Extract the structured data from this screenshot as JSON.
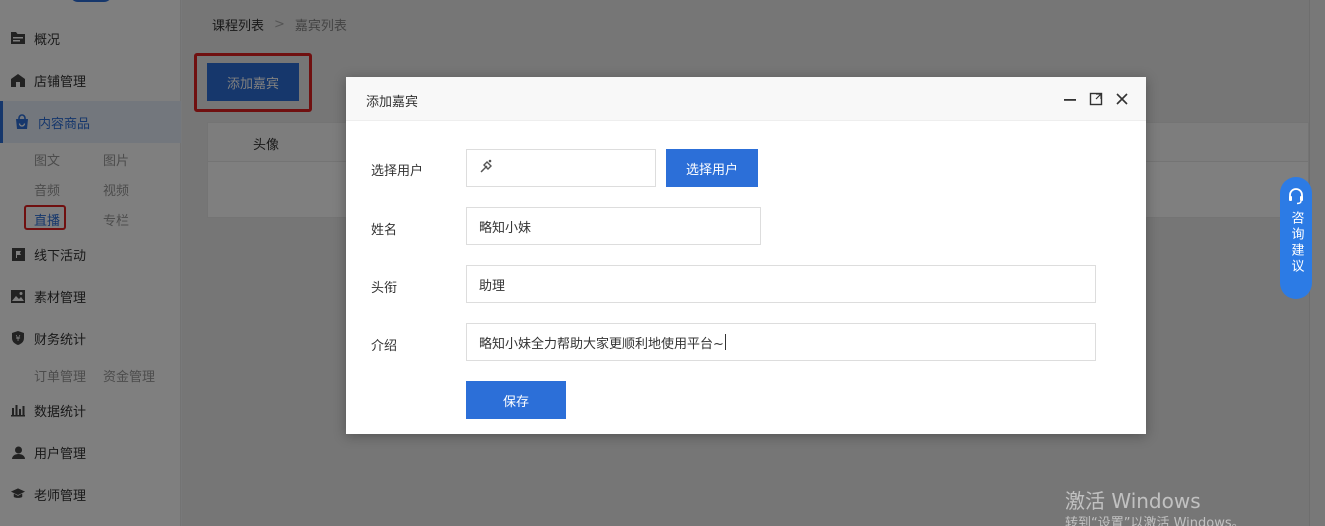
{
  "sidebar": {
    "items": [
      {
        "label": "概况",
        "icon": "folder-icon"
      },
      {
        "label": "店铺管理",
        "icon": "shop-icon"
      },
      {
        "label": "内容商品",
        "icon": "bag-icon"
      },
      {
        "label": "线下活动",
        "icon": "flag-icon"
      },
      {
        "label": "素材管理",
        "icon": "image-icon"
      },
      {
        "label": "财务统计",
        "icon": "yen-shield-icon"
      },
      {
        "label": "数据统计",
        "icon": "bar-chart-icon"
      },
      {
        "label": "用户管理",
        "icon": "user-icon"
      },
      {
        "label": "老师管理",
        "icon": "graduation-cap-icon"
      }
    ],
    "content_sub": [
      "图文",
      "图片",
      "音频",
      "视频",
      "直播",
      "专栏"
    ],
    "finance_sub": [
      "订单管理",
      "资金管理"
    ]
  },
  "breadcrumb": {
    "root": "课程列表",
    "separator": ">",
    "current": "嘉宾列表"
  },
  "toolbar": {
    "add_label": "添加嘉宾"
  },
  "table": {
    "columns": [
      "头像"
    ]
  },
  "dialog": {
    "title": "添加嘉宾",
    "fields": {
      "user_label": "选择用户",
      "user_button": "选择用户",
      "name_label": "姓名",
      "name_value": "略知小妹",
      "title_label": "头衔",
      "title_value": "助理",
      "intro_label": "介绍",
      "intro_value": "略知小妹全力帮助大家更顺利地使用平台~"
    },
    "save_label": "保存"
  },
  "consult": {
    "label": "咨询建议"
  },
  "watermark": {
    "line1": "激活 Windows",
    "line2": "转到“设置”以激活 Windows。"
  },
  "colors": {
    "primary": "#2c6fd8",
    "highlight": "#e02020",
    "consult": "#2c7be5"
  }
}
